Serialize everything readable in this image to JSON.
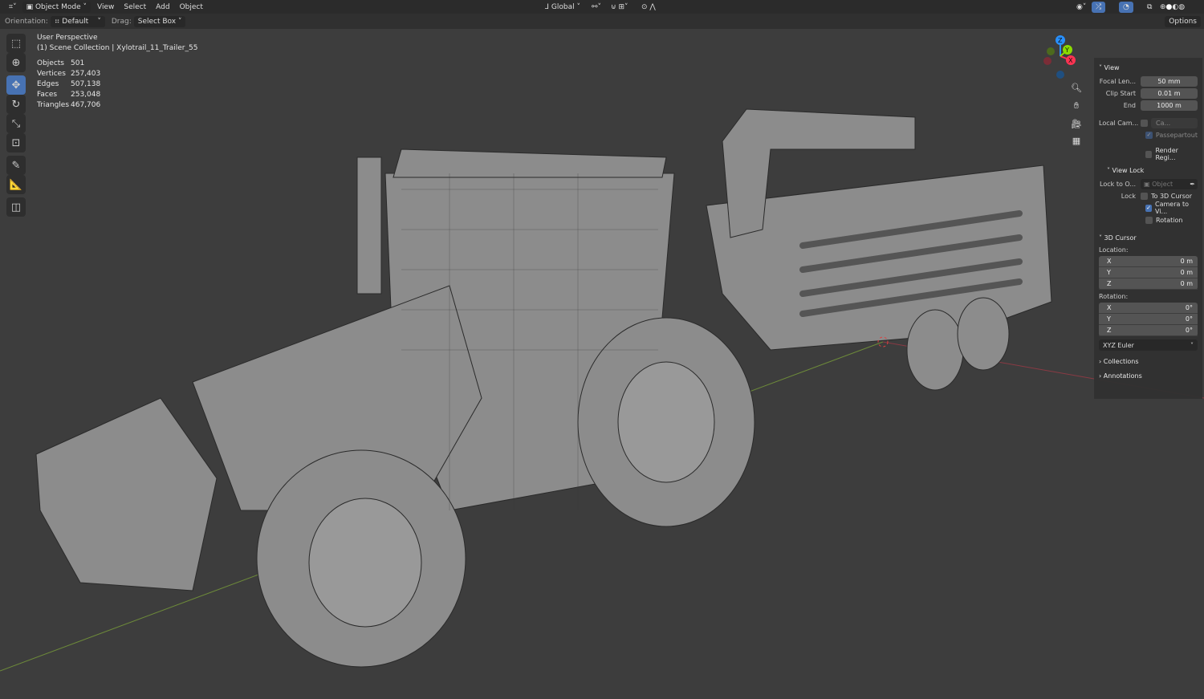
{
  "header": {
    "mode": "Object Mode",
    "menus": [
      "View",
      "Select",
      "Add",
      "Object"
    ],
    "transform_orientation": "Global",
    "options": "Options"
  },
  "toolbar": {
    "orientation_label": "Orientation:",
    "orientation_value": "Default",
    "drag_label": "Drag:",
    "drag_value": "Select Box"
  },
  "overlay": {
    "view_name": "User Perspective",
    "collection": "(1) Scene Collection | Xylotrail_11_Trailer_55",
    "stats": [
      {
        "k": "Objects",
        "v": "501"
      },
      {
        "k": "Vertices",
        "v": "257,403"
      },
      {
        "k": "Edges",
        "v": "507,138"
      },
      {
        "k": "Faces",
        "v": "253,048"
      },
      {
        "k": "Triangles",
        "v": "467,706"
      }
    ]
  },
  "gizmo": {
    "x": "X",
    "y": "Y",
    "z": "Z",
    "x_color": "#ff3352",
    "y_color": "#8bdc00",
    "z_color": "#2890ff"
  },
  "panel": {
    "view": {
      "title": "View",
      "focal_label": "Focal Len...",
      "focal": "50 mm",
      "clip_start_label": "Clip Start",
      "clip_start": "0.01 m",
      "end_label": "End",
      "end": "1000 m",
      "local_cam_label": "Local Cam...",
      "local_cam_value": "Ca...",
      "passepartout": "Passepartout",
      "render_region": "Render Regi..."
    },
    "view_lock": {
      "title": "View Lock",
      "lock_to_label": "Lock to O...",
      "lock_to_placeholder": "Object",
      "lock_label": "Lock",
      "to_cursor": "To 3D Cursor",
      "camera_to_view": "Camera to Vi...",
      "rotation": "Rotation"
    },
    "cursor": {
      "title": "3D Cursor",
      "location_label": "Location:",
      "loc": [
        {
          "a": "X",
          "v": "0 m"
        },
        {
          "a": "Y",
          "v": "0 m"
        },
        {
          "a": "Z",
          "v": "0 m"
        }
      ],
      "rotation_label": "Rotation:",
      "rot": [
        {
          "a": "X",
          "v": "0°"
        },
        {
          "a": "Y",
          "v": "0°"
        },
        {
          "a": "Z",
          "v": "0°"
        }
      ],
      "rotation_mode": "XYZ Euler"
    },
    "collections": "Collections",
    "annotations": "Annotations"
  }
}
